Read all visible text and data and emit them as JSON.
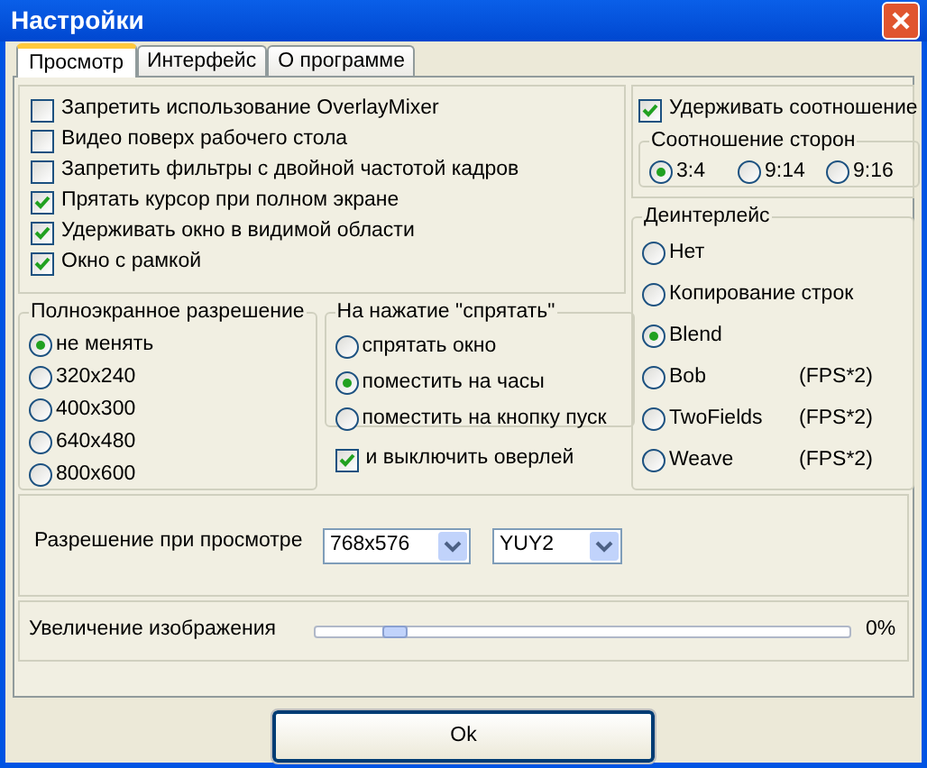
{
  "window": {
    "title": "Настройки"
  },
  "tabs": [
    {
      "label": "Просмотр",
      "selected": true
    },
    {
      "label": "Интерфейс",
      "selected": false
    },
    {
      "label": "О программе",
      "selected": false
    }
  ],
  "options": [
    {
      "label": "Запретить использование OverlayMixer",
      "checked": false
    },
    {
      "label": "Видео поверх рабочего стола",
      "checked": false
    },
    {
      "label": "Запретить фильтры с двойной частотой кадров",
      "checked": false
    },
    {
      "label": "Прятать курсор при полном экране",
      "checked": true
    },
    {
      "label": "Удерживать окно в видимой области",
      "checked": true
    },
    {
      "label": "Окно с рамкой",
      "checked": true
    }
  ],
  "fullscreen_resolution": {
    "title": "Полноэкранное разрешение",
    "options": [
      {
        "label": "не менять",
        "selected": true
      },
      {
        "label": "320x240",
        "selected": false
      },
      {
        "label": "400x300",
        "selected": false
      },
      {
        "label": "640x480",
        "selected": false
      },
      {
        "label": "800x600",
        "selected": false
      }
    ]
  },
  "on_hide": {
    "title": "На нажатие \"спрятать\"",
    "options": [
      {
        "label": "спрятать окно",
        "selected": false
      },
      {
        "label": "поместить на часы",
        "selected": true
      },
      {
        "label": "поместить на кнопку пуск",
        "selected": false
      }
    ]
  },
  "disable_overlay": {
    "label": "и выключить оверлей",
    "checked": true
  },
  "keep_ratio": {
    "label": "Удерживать соотношение",
    "checked": true
  },
  "aspect_ratio": {
    "title": "Соотношение сторон",
    "options": [
      {
        "label": "3:4",
        "selected": true
      },
      {
        "label": "9:14",
        "selected": false
      },
      {
        "label": "9:16",
        "selected": false
      }
    ]
  },
  "deinterlace": {
    "title": "Деинтерлейс",
    "options": [
      {
        "label": "Нет",
        "selected": false
      },
      {
        "label": "Копирование строк",
        "selected": false
      },
      {
        "label": "Blend",
        "selected": true
      },
      {
        "label": "Bob",
        "note": "(FPS*2)",
        "selected": false
      },
      {
        "label": "TwoFields",
        "note": "(FPS*2)",
        "selected": false
      },
      {
        "label": "Weave",
        "note": "(FPS*2)",
        "selected": false
      }
    ]
  },
  "preview_resolution": {
    "label": "Разрешение при просмотре",
    "resolution": "768x576",
    "format": "YUY2"
  },
  "zoom": {
    "label": "Увеличение изображения",
    "level": 0.13,
    "reading": "0%"
  },
  "buttons": [
    "Ok"
  ]
}
